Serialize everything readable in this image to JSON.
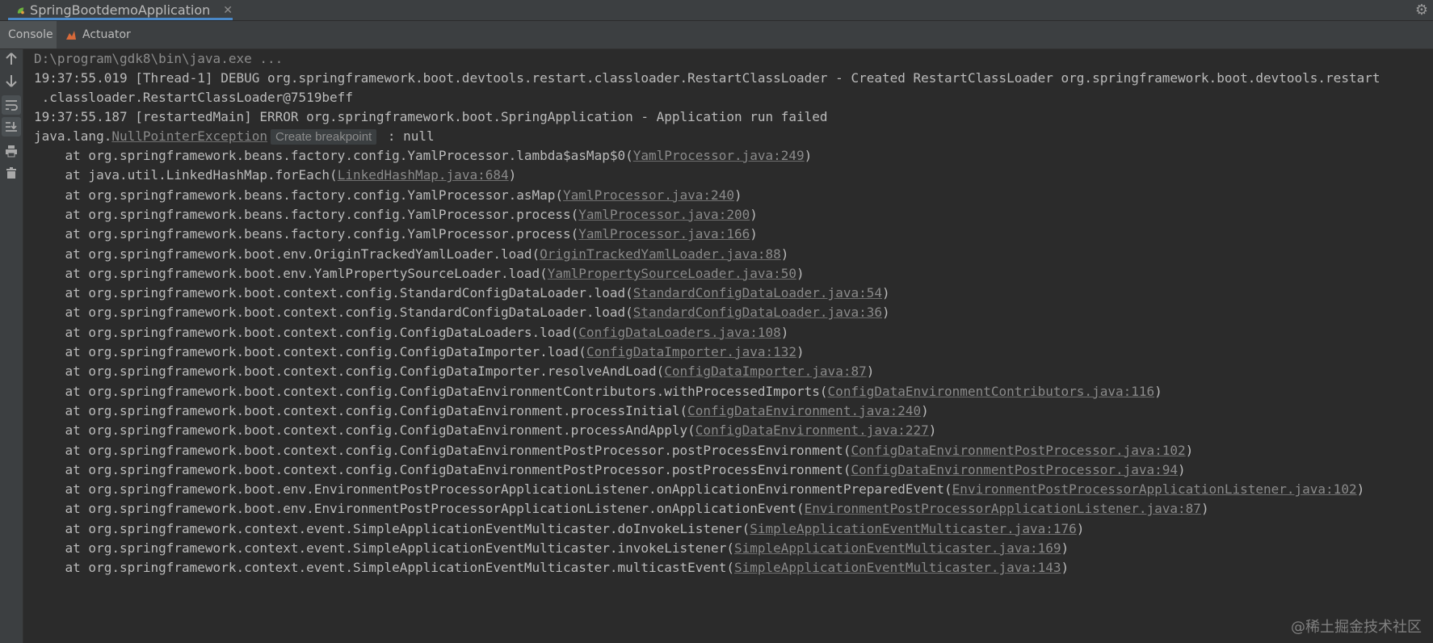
{
  "run_tab": {
    "label": "SpringBootdemoApplication",
    "close": "✕"
  },
  "sub_tabs": [
    {
      "label": "Console"
    },
    {
      "label": "Actuator"
    }
  ],
  "toolbar": [
    {
      "icon": "up-arrow-icon"
    },
    {
      "icon": "down-arrow-icon"
    },
    {
      "icon": "soft-wrap-icon"
    },
    {
      "icon": "scroll-to-end-icon"
    },
    {
      "icon": "print-icon"
    },
    {
      "icon": "trash-icon"
    }
  ],
  "console": {
    "cmd": "D:\\program\\gdk8\\bin\\java.exe ...",
    "debug_line_1": "19:37:55.019 [Thread-1] DEBUG org.springframework.boot.devtools.restart.classloader.RestartClassLoader - Created RestartClassLoader org.springframework.boot.devtools.restart",
    "debug_line_2": " .classloader.RestartClassLoader@7519beff",
    "error_line": "19:37:55.187 [restartedMain] ERROR org.springframework.boot.SpringApplication - Application run failed",
    "exception": {
      "prefix": "java.lang.",
      "name": "NullPointerException",
      "hint": "Create breakpoint",
      "suffix": " : null"
    },
    "stack": [
      {
        "text": "    at org.springframework.beans.factory.config.YamlProcessor.lambda$asMap$0(",
        "link": "YamlProcessor.java:249"
      },
      {
        "text": "    at java.util.LinkedHashMap.forEach(",
        "link": "LinkedHashMap.java:684"
      },
      {
        "text": "    at org.springframework.beans.factory.config.YamlProcessor.asMap(",
        "link": "YamlProcessor.java:240"
      },
      {
        "text": "    at org.springframework.beans.factory.config.YamlProcessor.process(",
        "link": "YamlProcessor.java:200"
      },
      {
        "text": "    at org.springframework.beans.factory.config.YamlProcessor.process(",
        "link": "YamlProcessor.java:166"
      },
      {
        "text": "    at org.springframework.boot.env.OriginTrackedYamlLoader.load(",
        "link": "OriginTrackedYamlLoader.java:88"
      },
      {
        "text": "    at org.springframework.boot.env.YamlPropertySourceLoader.load(",
        "link": "YamlPropertySourceLoader.java:50"
      },
      {
        "text": "    at org.springframework.boot.context.config.StandardConfigDataLoader.load(",
        "link": "StandardConfigDataLoader.java:54"
      },
      {
        "text": "    at org.springframework.boot.context.config.StandardConfigDataLoader.load(",
        "link": "StandardConfigDataLoader.java:36"
      },
      {
        "text": "    at org.springframework.boot.context.config.ConfigDataLoaders.load(",
        "link": "ConfigDataLoaders.java:108"
      },
      {
        "text": "    at org.springframework.boot.context.config.ConfigDataImporter.load(",
        "link": "ConfigDataImporter.java:132"
      },
      {
        "text": "    at org.springframework.boot.context.config.ConfigDataImporter.resolveAndLoad(",
        "link": "ConfigDataImporter.java:87"
      },
      {
        "text": "    at org.springframework.boot.context.config.ConfigDataEnvironmentContributors.withProcessedImports(",
        "link": "ConfigDataEnvironmentContributors.java:116"
      },
      {
        "text": "    at org.springframework.boot.context.config.ConfigDataEnvironment.processInitial(",
        "link": "ConfigDataEnvironment.java:240"
      },
      {
        "text": "    at org.springframework.boot.context.config.ConfigDataEnvironment.processAndApply(",
        "link": "ConfigDataEnvironment.java:227"
      },
      {
        "text": "    at org.springframework.boot.context.config.ConfigDataEnvironmentPostProcessor.postProcessEnvironment(",
        "link": "ConfigDataEnvironmentPostProcessor.java:102"
      },
      {
        "text": "    at org.springframework.boot.context.config.ConfigDataEnvironmentPostProcessor.postProcessEnvironment(",
        "link": "ConfigDataEnvironmentPostProcessor.java:94"
      },
      {
        "text": "    at org.springframework.boot.env.EnvironmentPostProcessorApplicationListener.onApplicationEnvironmentPreparedEvent(",
        "link": "EnvironmentPostProcessorApplicationListener.java:102"
      },
      {
        "text": "    at org.springframework.boot.env.EnvironmentPostProcessorApplicationListener.onApplicationEvent(",
        "link": "EnvironmentPostProcessorApplicationListener.java:87"
      },
      {
        "text": "    at org.springframework.context.event.SimpleApplicationEventMulticaster.doInvokeListener(",
        "link": "SimpleApplicationEventMulticaster.java:176"
      },
      {
        "text": "    at org.springframework.context.event.SimpleApplicationEventMulticaster.invokeListener(",
        "link": "SimpleApplicationEventMulticaster.java:169"
      },
      {
        "text": "    at org.springframework.context.event.SimpleApplicationEventMulticaster.multicastEvent(",
        "link": "SimpleApplicationEventMulticaster.java:143"
      }
    ]
  },
  "watermark": "@稀土掘金技术社区"
}
